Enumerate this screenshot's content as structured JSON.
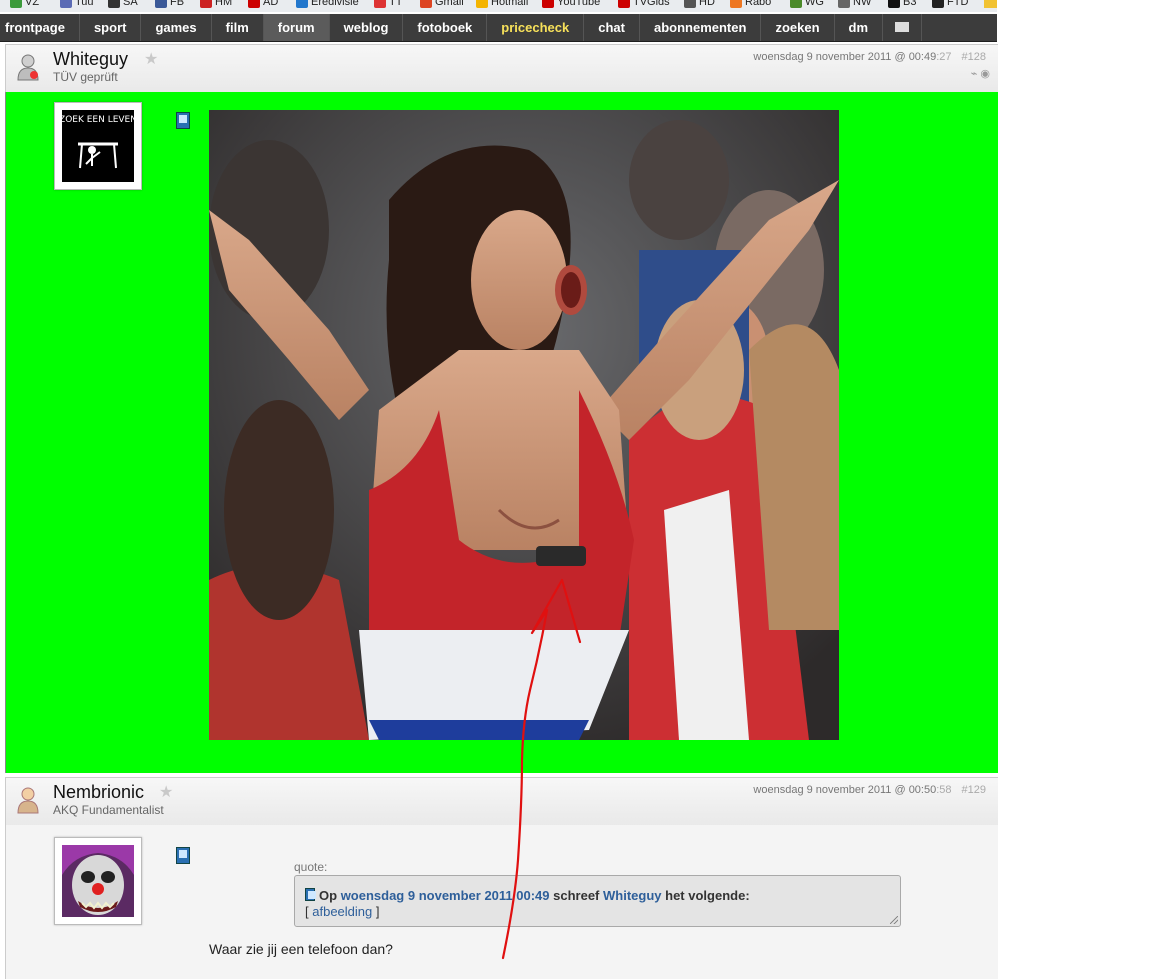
{
  "bookmarks": [
    {
      "label": "VZ",
      "color": "#3b9a3b"
    },
    {
      "label": "Tuu",
      "color": "#5b6bb5"
    },
    {
      "label": "SA",
      "color": "#333333"
    },
    {
      "label": "FB",
      "color": "#3b5998"
    },
    {
      "label": "HM",
      "color": "#cc2222"
    },
    {
      "label": "AD",
      "color": "#cc0000"
    },
    {
      "label": "Eredivisie",
      "color": "#2277cc"
    },
    {
      "label": "TT",
      "color": "#dd3333"
    },
    {
      "label": "Gmail",
      "color": "#dd4422"
    },
    {
      "label": "Hotmail",
      "color": "#f4b400"
    },
    {
      "label": "YouTube",
      "color": "#cc0000"
    },
    {
      "label": "TVGids",
      "color": "#cc0000"
    },
    {
      "label": "HD",
      "color": "#555555"
    },
    {
      "label": "Rabo",
      "color": "#ee7722"
    },
    {
      "label": "WG",
      "color": "#4a8a2a"
    },
    {
      "label": "NW",
      "color": "#666666"
    },
    {
      "label": "B3",
      "color": "#111111"
    },
    {
      "label": "FTD",
      "color": "#222222"
    }
  ],
  "nav": {
    "tabs": [
      {
        "label": "frontpage",
        "name": "tab-frontpage"
      },
      {
        "label": "sport",
        "name": "tab-sport"
      },
      {
        "label": "games",
        "name": "tab-games"
      },
      {
        "label": "film",
        "name": "tab-film"
      },
      {
        "label": "forum",
        "name": "tab-forum",
        "active": true
      },
      {
        "label": "weblog",
        "name": "tab-weblog"
      },
      {
        "label": "fotoboek",
        "name": "tab-fotoboek"
      },
      {
        "label": "pricecheck",
        "name": "tab-pricecheck",
        "highlight": true
      },
      {
        "label": "chat",
        "name": "tab-chat"
      },
      {
        "label": "abonnementen",
        "name": "tab-abonnementen"
      },
      {
        "label": "zoeken",
        "name": "tab-zoeken"
      },
      {
        "label": "dm",
        "name": "tab-dm"
      }
    ],
    "mail_icon": "envelope-icon"
  },
  "posts": [
    {
      "username": "Whiteguy",
      "user_title": "TÜV geprüft",
      "date": "woensdag 9 november 2011 @ 00:49",
      "seconds": ":27",
      "number": "#128",
      "avatar_text": "ZOEK EEN LEVEN",
      "body_color": "#00ff00"
    },
    {
      "username": "Nembrionic",
      "user_title": "AKQ Fundamentalist",
      "date": "woensdag 9 november 2011 @ 00:50",
      "seconds": ":58",
      "number": "#129",
      "quote_label": "quote:",
      "quote_op": "Op",
      "quote_date": "woensdag 9 november 2011 00:49",
      "quote_wrote": "schreef",
      "quote_user": "Whiteguy",
      "quote_rest": "het volgende:",
      "quote_bracket_open": "[",
      "quote_link": "afbeelding",
      "quote_bracket_close": "]",
      "reply": "Waar zie jij een telefoon dan?"
    }
  ],
  "colors": {
    "nav_bg": "#3c3c3c",
    "link": "#2e5f9a",
    "annotation": "#e01010"
  }
}
